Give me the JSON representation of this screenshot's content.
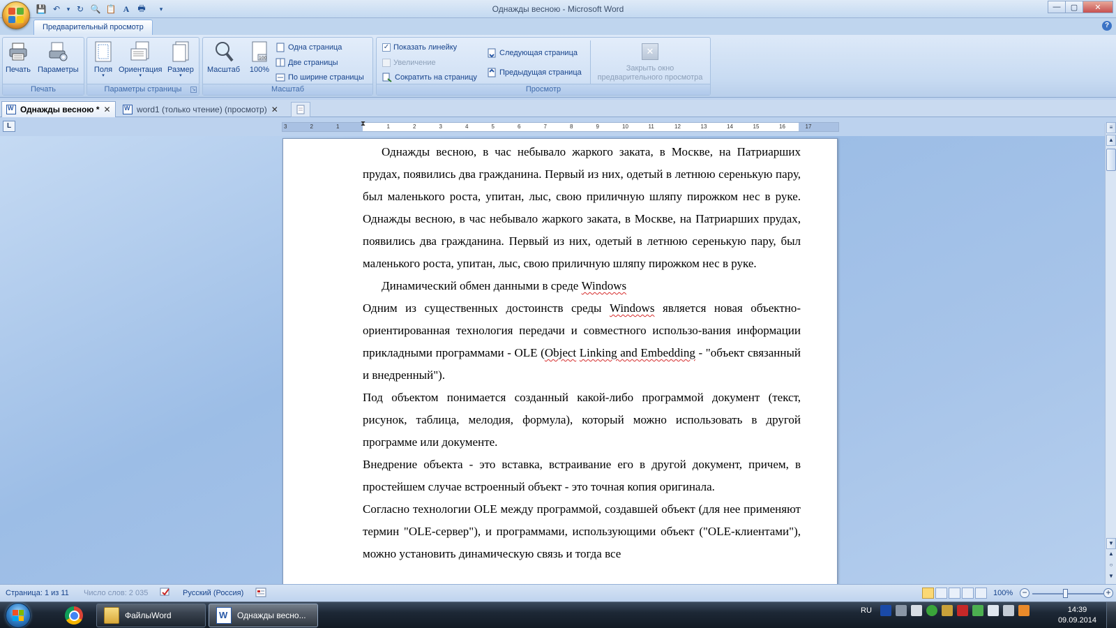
{
  "window": {
    "title": "Однажды весною - Microsoft Word",
    "min": "—",
    "max": "▢",
    "close": "✕"
  },
  "qat": {
    "save": "💾",
    "undo": "↶",
    "undo_arrow": "▾",
    "redo": "↻",
    "preview": "🔍",
    "paste": "📋",
    "font": "A",
    "print": "🖶",
    "customize": "▾"
  },
  "ribbon": {
    "active_tab": "Предварительный просмотр",
    "help": "?",
    "groups": {
      "print": {
        "label": "Печать",
        "print_label": "Печать",
        "params_label": "Параметры"
      },
      "page_setup": {
        "label": "Параметры страницы",
        "launcher": "↘",
        "fields_label": "Поля",
        "orientation_label": "Ориентация",
        "size_label": "Размер",
        "caret": "▾"
      },
      "zoom": {
        "label": "Масштаб",
        "zoom_label": "Масштаб",
        "percent_label": "100%",
        "one_page": "Одна страница",
        "two_pages": "Две страницы",
        "page_width": "По ширине страницы"
      },
      "preview": {
        "label": "Просмотр",
        "show_ruler": "Показать линейку",
        "show_ruler_checked": "✓",
        "magnifier": "Увеличение",
        "shrink": "Сократить на страницу",
        "next_page": "Следующая страница",
        "prev_page": "Предыдущая страница"
      },
      "close": {
        "label_line1": "Закрыть окно",
        "label_line2": "предварительного просмотра",
        "icon": "✕"
      }
    }
  },
  "doc_tabs": [
    {
      "label": "Однажды весною *",
      "close": "✕"
    },
    {
      "label": "word1 (только чтение) (просмотр)",
      "close": "✕"
    }
  ],
  "ruler": {
    "corner": "L",
    "numbers": [
      "3",
      "2",
      "1",
      "1",
      "2",
      "3",
      "4",
      "5",
      "6",
      "7",
      "8",
      "9",
      "10",
      "11",
      "12",
      "13",
      "14",
      "15",
      "16",
      "17"
    ]
  },
  "document": {
    "p1": "Однажды весною, в час небывало жаркого заката, в Москве, на Патриарших прудах, появились два гражданина. Первый из них, одетый в летнюю серенькую пару, был маленького роста, упитан, лыс, свою приличную шляпу пирожком нес в руке. Однажды весною, в час небывало жаркого заката, в Москве, на Патриарших прудах, появились два гражданина. Первый из них, одетый в летнюю серенькую пару, был маленького роста, упитан, лыс, свою приличную шляпу пирожком нес в руке.",
    "p2_text": "Динамический обмен данными в среде ",
    "p2_sq": "Windows",
    "p3_a": "Одним из существенных достоинств среды ",
    "p3_sq1": "Windows",
    "p3_b": "  является новая объектно-ориентированная  технология передачи и совместного использо-вания  информации  прикладными  программами - OLE (",
    "p3_sq2": "Object",
    "p3_c": "  ",
    "p3_sq3": "Linking and Embedding",
    "p3_d": " - \"объект связанный и внедренный\").",
    "p4": "Под  объектом  понимается  созданный  какой-либо  программой  документ (текст,  рисунок, таблица, мелодия, формула), который можно использовать в другой программе или документе.",
    "p5": "Внедрение объекта - это вставка, встраивание его в другой документ, причем, в простейшем случае встроенный объект - это точная копия оригинала.",
    "p6": "Согласно технологии OLE между программой, создавшей объект (для нее применяют термин \"OLE-сервер\"), и программами, использующими объект (\"OLE-клиентами\"), можно  установить динамическую связь и тогда все"
  },
  "scrollbar": {
    "up": "▲",
    "down": "▼",
    "prev": "▲",
    "browse": "○",
    "next": "▼",
    "top_btn": "≡"
  },
  "status": {
    "page": "Страница: 1 из 11",
    "words": "Число слов: 2 035",
    "language": "Русский (Россия)",
    "zoom": "100%",
    "zoom_minus": "−",
    "zoom_plus": "+"
  },
  "taskbar": {
    "folder_label": "ФайлыWord",
    "word_label": "Однажды весно...",
    "lang": "RU",
    "time": "14:39",
    "date": "09.09.2014"
  },
  "colors": {
    "ribbon_text": "#15428b",
    "squiggle": "#d62b2b",
    "office_logo": [
      "#e4572e",
      "#5fb236",
      "#2f7fd1",
      "#f5c518"
    ],
    "win_flag": [
      "#f25022",
      "#7fba00",
      "#00a4ef",
      "#ffb900"
    ]
  }
}
